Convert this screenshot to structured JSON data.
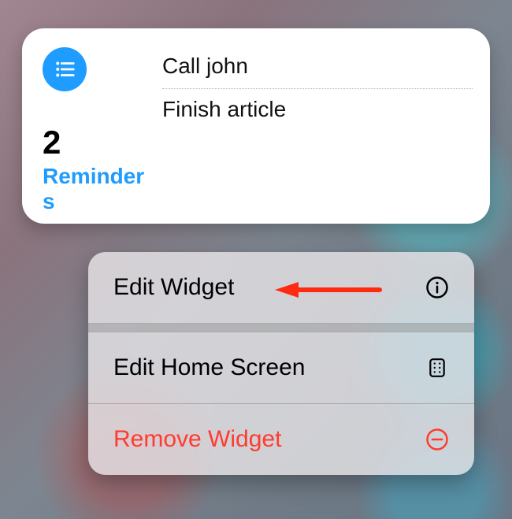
{
  "widget": {
    "app_name": "Reminders",
    "count": "2",
    "items": [
      "Call john",
      "Finish article"
    ]
  },
  "menu": {
    "edit_widget": "Edit Widget",
    "edit_home": "Edit Home Screen",
    "remove": "Remove Widget"
  },
  "colors": {
    "accent": "#1e9cff",
    "destructive": "#ff3b30"
  }
}
